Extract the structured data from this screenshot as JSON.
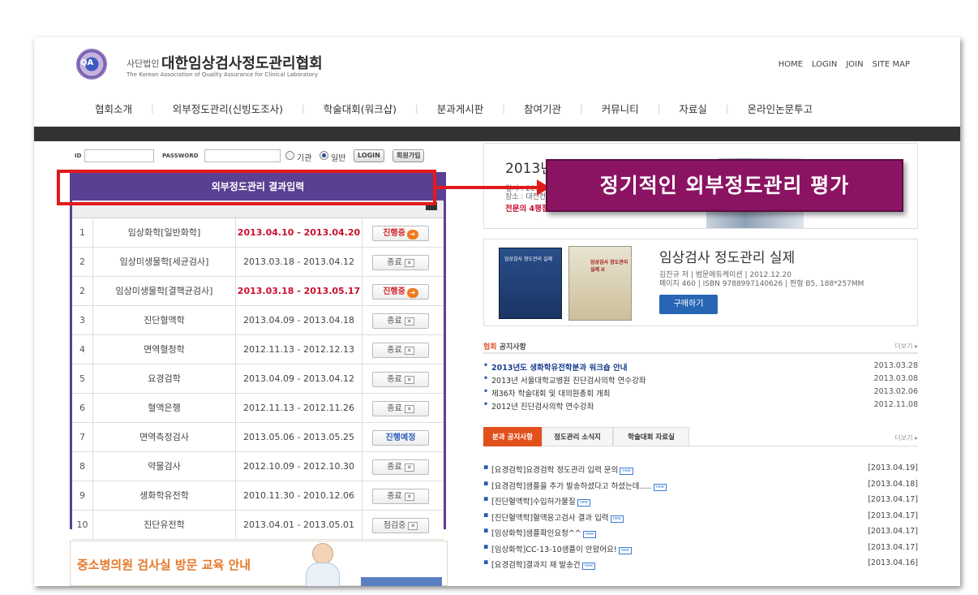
{
  "header": {
    "logo_text": "QA",
    "org_prefix": "사단법인",
    "org_name": "대한임상검사정도관리협회",
    "org_en": "The Korean Association of Quality Assurance for Clinical Laboratory",
    "top_links": [
      "HOME",
      "LOGIN",
      "JOIN",
      "SITE MAP"
    ]
  },
  "nav": [
    "협회소개",
    "외부정도관리(신빙도조사)",
    "학술대회(워크샵)",
    "분과게시판",
    "참여기관",
    "커뮤니티",
    "자료실",
    "온라인논문투고"
  ],
  "login": {
    "id_label": "ID",
    "pw_label": "PASSWORD",
    "radio_org": "기관",
    "radio_general": "일반",
    "login_btn": "LOGIN",
    "join_btn": "회원가입"
  },
  "result_panel": {
    "title": "외부정도관리 결과입력",
    "rows": [
      {
        "num": "1",
        "name": "임상화학[일반화학]",
        "date": "2013.04.10 - 2013.04.20",
        "status": "진행중",
        "hot": true
      },
      {
        "num": "2",
        "name": "임상미생물학[세균검사]",
        "date": "2013.03.18 - 2013.04.12",
        "status": "종료",
        "hot": false
      },
      {
        "num": "2",
        "name": "임상미생물학[결핵균검사]",
        "date": "2013.03.18 - 2013.05.17",
        "status": "진행중",
        "hot": true
      },
      {
        "num": "3",
        "name": "진단혈액학",
        "date": "2013.04.09 - 2013.04.18",
        "status": "종료",
        "hot": false
      },
      {
        "num": "4",
        "name": "면역혈청학",
        "date": "2012.11.13 - 2012.12.13",
        "status": "종료",
        "hot": false
      },
      {
        "num": "5",
        "name": "요경검학",
        "date": "2013.04.09 - 2013.04.12",
        "status": "종료",
        "hot": false
      },
      {
        "num": "6",
        "name": "혈액은행",
        "date": "2012.11.13 - 2012.11.26",
        "status": "종료",
        "hot": false
      },
      {
        "num": "7",
        "name": "면역측정검사",
        "date": "2013.05.06 - 2013.05.25",
        "status": "진행예정",
        "hot": false
      },
      {
        "num": "8",
        "name": "약물검사",
        "date": "2012.10.09 - 2012.10.30",
        "status": "종료",
        "hot": false
      },
      {
        "num": "9",
        "name": "생화학유전학",
        "date": "2010.11.30 - 2010.12.06",
        "status": "종료",
        "hot": false
      },
      {
        "num": "10",
        "name": "진단유전학",
        "date": "2013.04.01 - 2013.05.01",
        "status": "점검중",
        "hot": false
      }
    ]
  },
  "callout": "정기적인 외부정도관리 평가",
  "edu_banner": {
    "title": "중소병의원 검사실 방문 교육 안내"
  },
  "conference": {
    "title": "2013년도 추계학술대회",
    "date_line": "일시 : 2013년 10월 11일(금)",
    "place_line": "장소 : 대전컨벤션센터",
    "credit_line": "전문의 4평점/병리"
  },
  "book": {
    "cover1": "임상검사 정도관리 실제",
    "cover2": "임상검사 정도관리 실제 II",
    "title": "임상검사 정도관리 실제",
    "line1": "김진규 저 | 범문에듀케이션 | 2012.12.20",
    "line2": "페이지 460 | ISBN 9788997140626 | 판형 B5, 188*257MM",
    "buy_btn": "구매하기"
  },
  "notices": {
    "header_prefix": "협회",
    "header_rest": " 공지사항",
    "more": "더보기 ▸",
    "items": [
      {
        "text": "2013년도 생화학유전학분과 워크숍 안내",
        "date": "2013.03.28",
        "bold": true
      },
      {
        "text": "2013년 서울대학교병원 진단검사의학 연수강좌",
        "date": "2013.03.08",
        "bold": false
      },
      {
        "text": "제36차 학술대회 및 대의원총회 개최",
        "date": "2013.02.06",
        "bold": false
      },
      {
        "text": "2012년 진단검사의학 연수강좌",
        "date": "2012.11.08",
        "bold": false
      }
    ]
  },
  "board_tabs": {
    "tabs": [
      "분과 공지사항",
      "정도관리 소식지",
      "학술대회 자료실"
    ],
    "more": "더보기 ▸",
    "new_badge": "new",
    "items": [
      {
        "text": "[요경검학]요경검학 정도관리 입력 문의",
        "date": "[2013.04.19]"
      },
      {
        "text": "[요경검학]샘플을 추가 발송하셨다고 하셨는데.....",
        "date": "[2013.04.18]"
      },
      {
        "text": "[진단혈액학]수입허가물질",
        "date": "[2013.04.17]"
      },
      {
        "text": "[진단혈액학]혈액응고검사 결과 입력",
        "date": "[2013.04.17]"
      },
      {
        "text": "[임상화학]샘플확인요청^^",
        "date": "[2013.04.17]"
      },
      {
        "text": "[임상화학]CC-13-10샘플이 안왔어요!",
        "date": "[2013.04.17]"
      },
      {
        "text": "[요경검학]결과지 재 발송건",
        "date": "[2013.04.16]"
      }
    ]
  }
}
